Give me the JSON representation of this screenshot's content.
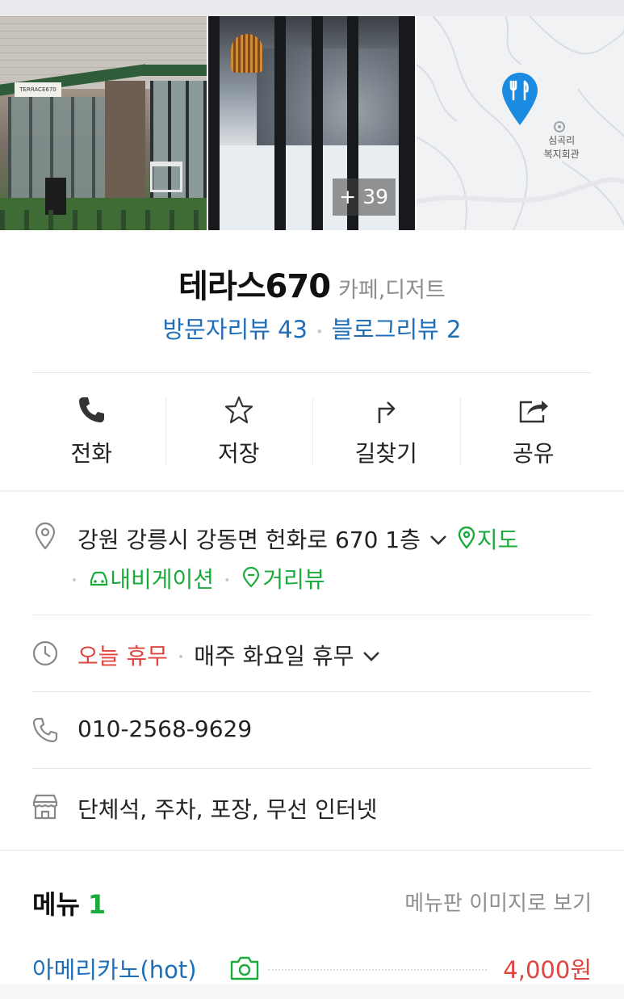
{
  "gallery": {
    "storefront_sign": "TERRACE670",
    "extra_photo_count": "+ 39",
    "map_label": "심곡리\n복지회관"
  },
  "place": {
    "name": "테라스670",
    "category": "카페,디저트",
    "visitor_reviews": "방문자리뷰 43",
    "blog_reviews": "블로그리뷰 2"
  },
  "actions": [
    {
      "label": "전화",
      "icon": "phone-icon"
    },
    {
      "label": "저장",
      "icon": "star-icon"
    },
    {
      "label": "길찾기",
      "icon": "directions-icon"
    },
    {
      "label": "공유",
      "icon": "share-icon"
    }
  ],
  "info": {
    "address": "강원 강릉시 강동면 헌화로 670 1층",
    "map_link": "지도",
    "navigation_link": "내비게이션",
    "streetview_link": "거리뷰",
    "hours_status": "오늘 휴무",
    "hours_detail": "매주 화요일 휴무",
    "phone": "010-2568-9629",
    "amenities": "단체석, 주차, 포장, 무선 인터넷"
  },
  "menu": {
    "title": "메뉴",
    "count": "1",
    "board_link": "메뉴판 이미지로 보기",
    "items": [
      {
        "name": "아메리카노(hot)",
        "price": "4,000원"
      }
    ]
  },
  "colors": {
    "link_blue": "#1f6fb8",
    "green": "#1aab3a",
    "red": "#e0443e",
    "map_pin": "#1a8be0"
  }
}
